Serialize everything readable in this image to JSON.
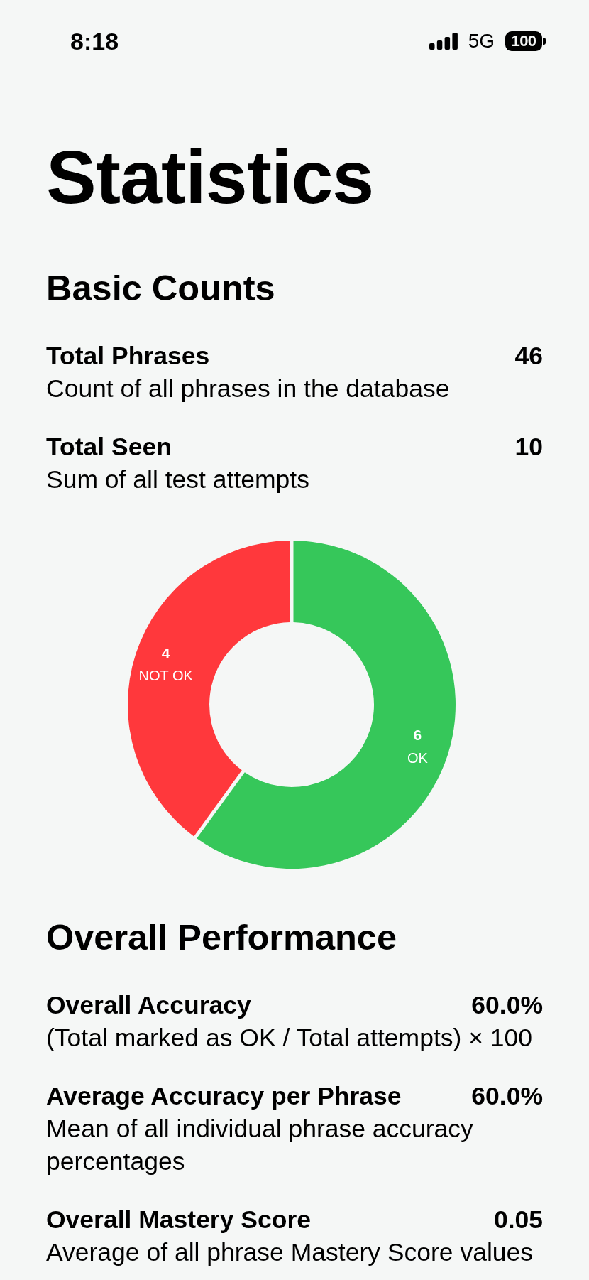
{
  "status_bar": {
    "time": "8:18",
    "network": "5G",
    "battery": "100"
  },
  "title": "Statistics",
  "sections": [
    {
      "heading": "Basic Counts",
      "stats": [
        {
          "label": "Total Phrases",
          "value": "46",
          "description": "Count of all phrases in the database"
        },
        {
          "label": "Total Seen",
          "value": "10",
          "description": "Sum of all test attempts"
        }
      ],
      "chart_data": {
        "type": "donut",
        "categories": [
          "OK",
          "NOT OK"
        ],
        "values": [
          6,
          4
        ],
        "colors": [
          "#36c75a",
          "#ff383c"
        ],
        "data_labels": true
      }
    },
    {
      "heading": "Overall Performance",
      "stats": [
        {
          "label": "Overall Accuracy",
          "value": "60.0%",
          "description": "(Total marked as OK / Total attempts) × 100"
        },
        {
          "label": "Average Accuracy per Phrase",
          "value": "60.0%",
          "description": "Mean of all individual phrase accuracy percentages"
        },
        {
          "label": "Overall Mastery Score",
          "value": "0.05",
          "description": "Average of all phrase Mastery Score values"
        }
      ]
    }
  ]
}
